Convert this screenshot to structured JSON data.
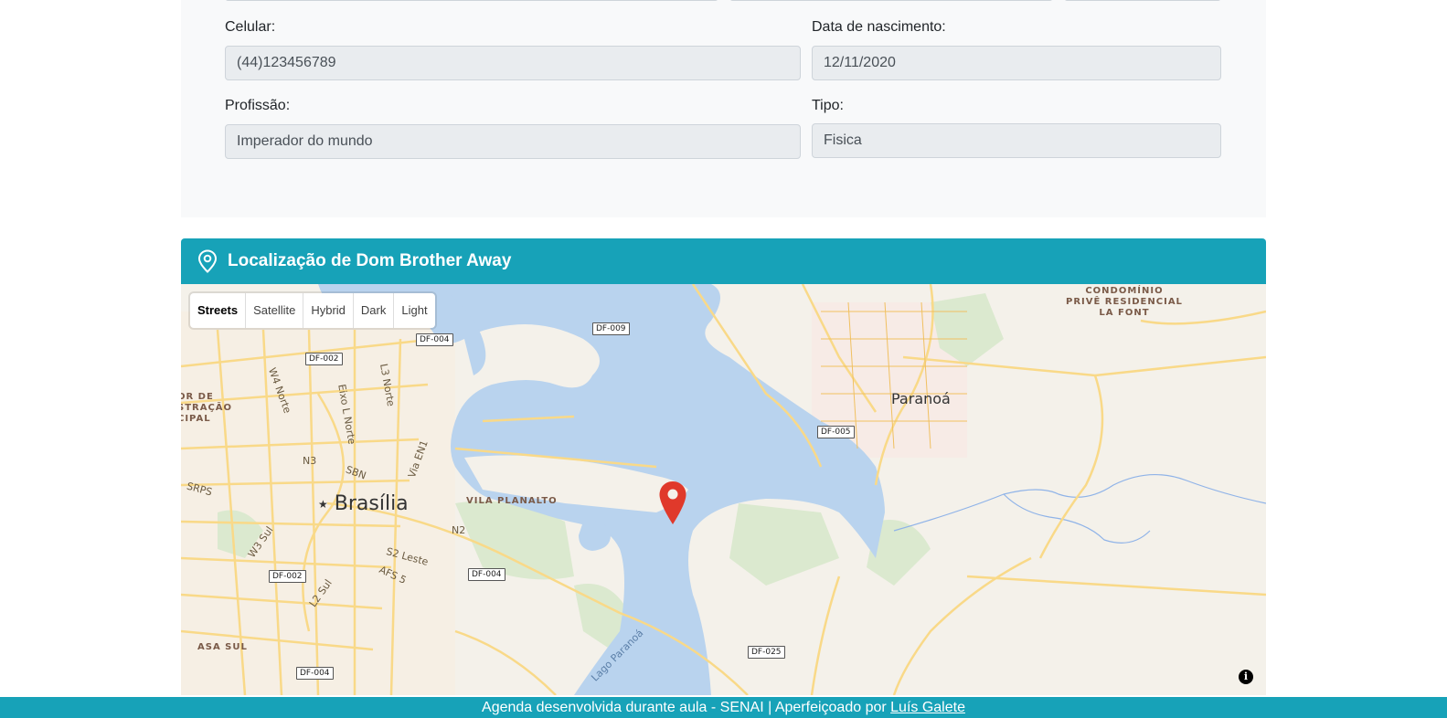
{
  "form": {
    "celular": {
      "label": "Celular:",
      "value": "(44)123456789"
    },
    "nascimento": {
      "label": "Data de nascimento:",
      "value": "12/11/2020"
    },
    "profissao": {
      "label": "Profissão:",
      "value": "Imperador do mundo"
    },
    "tipo": {
      "label": "Tipo:",
      "value": "Fisica"
    }
  },
  "map_card": {
    "title": "Localização de Dom Brother Away",
    "icon": "map-pin-outline-icon",
    "header_color": "#17a2b8"
  },
  "map": {
    "styles": [
      "Streets",
      "Satellite",
      "Hybrid",
      "Dark",
      "Light"
    ],
    "active_style": "Streets",
    "info_icon": "info-icon",
    "marker_color": "#e0392b",
    "labels": {
      "brasilia": "Brasília",
      "paranoa": "Paranoá",
      "vila_planalto": "VILA PLANALTO",
      "asa_sul": "ASA SUL",
      "condominio_1": "CONDOMÍNIO",
      "condominio_2": "PRIVÊ RESIDENCIAL",
      "condominio_3": "LA FONT",
      "admin_1": "OR DE",
      "admin_2": "STRAÇÃO",
      "admin_3": "CIPAL",
      "w4_norte": "W4 Norte",
      "eixo_l_norte": "Eixo L Norte",
      "l3_norte": "L3 Norte",
      "via_en1": "Via EN1",
      "n3": "N3",
      "sbn": "SBN",
      "n2": "N2",
      "srps": "SRPS",
      "w3_sul": "W3 Sul",
      "s2_leste": "S2 Leste",
      "afs5": "AFS 5",
      "l2_sul": "L2 Sul",
      "lago": "Lago Paranoá"
    },
    "shields": {
      "df009": "DF-009",
      "df004_a": "DF-004",
      "df002_a": "DF-002",
      "df005": "DF-005",
      "df004_b": "DF-004",
      "df002_b": "DF-002",
      "df025": "DF-025",
      "df004_c": "DF-004"
    }
  },
  "footer": {
    "text": "Agenda desenvolvida durante aula - SENAI | Aperfeiçoado por ",
    "link": "Luís Galete"
  }
}
